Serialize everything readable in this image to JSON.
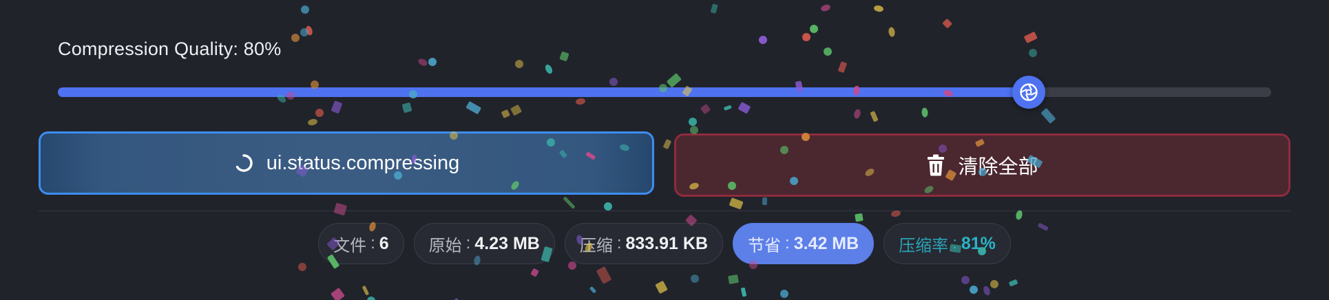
{
  "quality": {
    "label": "Compression Quality: 80%",
    "value_percent": 80,
    "accent_color": "#4e72f0",
    "thumb_icon": "aperture-icon"
  },
  "actions": {
    "compress_label": "ui.status.compressing",
    "compress_icon": "spinner-icon",
    "clear_label": "清除全部",
    "clear_icon": "trash-icon"
  },
  "stats": {
    "files_label": "文件",
    "files_value": "6",
    "original_label": "原始",
    "original_value": "4.23 MB",
    "compressed_label": "压缩",
    "compressed_value": "833.91 KB",
    "saved_label": "节省",
    "saved_value": "3.42 MB",
    "ratio_label": "压缩率",
    "ratio_value": "81%",
    "separator": ":"
  },
  "colors": {
    "background": "#21232b",
    "compress_border": "#3d8ef0",
    "clear_border": "#8f2c3c",
    "saved_chip": "#5c7fe8",
    "ratio_text": "#2ab3c6"
  }
}
